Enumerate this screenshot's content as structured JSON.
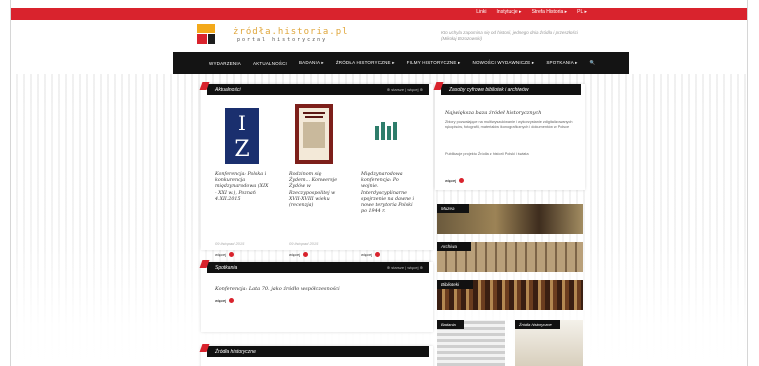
{
  "topnav": [
    "Linki",
    "Instytucje ▸",
    "Strefa Historia ▸",
    "PL ▸"
  ],
  "logo": {
    "text": "żródła.historia.pl",
    "subtitle": "portal historyczny",
    "small": "MUZEUM HISTORII POLSKI"
  },
  "quote": "Kto uchyla zapomina się od historii, jednego dnia źródła i przeszłości (Mikołaj Brzozowski)",
  "mainnav": [
    "WYDARZENIA",
    "AKTUALNOŚCI",
    "BADANIA ▸",
    "ŹRÓDŁA HISTORYCZNE ▸",
    "FILMY HISTORYCZNE ▸",
    "NOWOŚCI WYDAWNICZE ▸",
    "SPOTKANIA ▸",
    "🔍"
  ],
  "news": {
    "title": "Aktualności",
    "ctrl": "⊕ starsze | więcej ⊕",
    "cards": [
      {
        "title": "Konferencja: Polska i konkurencja międzynarodowa (XIX - XXI w.), Poznań 4.XII.2015",
        "date": "09 listopad 2015",
        "more": "więcej"
      },
      {
        "title": "Rodzinom się Żydem... Konwersje Żydów w Rzeczypospolitej w XVII-XVIII wieku (recenzja)",
        "date": "09 listopad 2015",
        "more": "więcej"
      },
      {
        "title": "Międzynarodowa konferencja: Po wojnie. Interdyscyplinarne spojrzenie na dawne i nowe terytoria Polski po 1944 r.",
        "date": "09 listopad 2015",
        "more": "więcej"
      }
    ]
  },
  "meetings": {
    "title": "Spotkania",
    "ctrl": "⊕ starsze | więcej ⊕",
    "item_label": "Konferencja:",
    "item_text": "Konferencja: Lata 70. jako źródło współczesności",
    "more": "więcej"
  },
  "sources": {
    "title": "Źródła historyczne"
  },
  "right": {
    "title": "Zasoby cyfrowe bibliotek i archiwów",
    "heading": "Największa baza źródeł historycznych",
    "p1": "Zbiory pozwalające na multiwyszukiwanie i wykorzystanie zdigitalizowanych rękopisów, fotografii, materiałów ikonograficznych i dokumentów w Polsce",
    "p2": "Publikacje projektu Źródła z historii Polski i świata",
    "more": "więcej",
    "bars": [
      "Muzea",
      "Archiwa",
      "Biblioteki"
    ],
    "mini": [
      "Badania",
      "Źródła historyczne"
    ]
  }
}
